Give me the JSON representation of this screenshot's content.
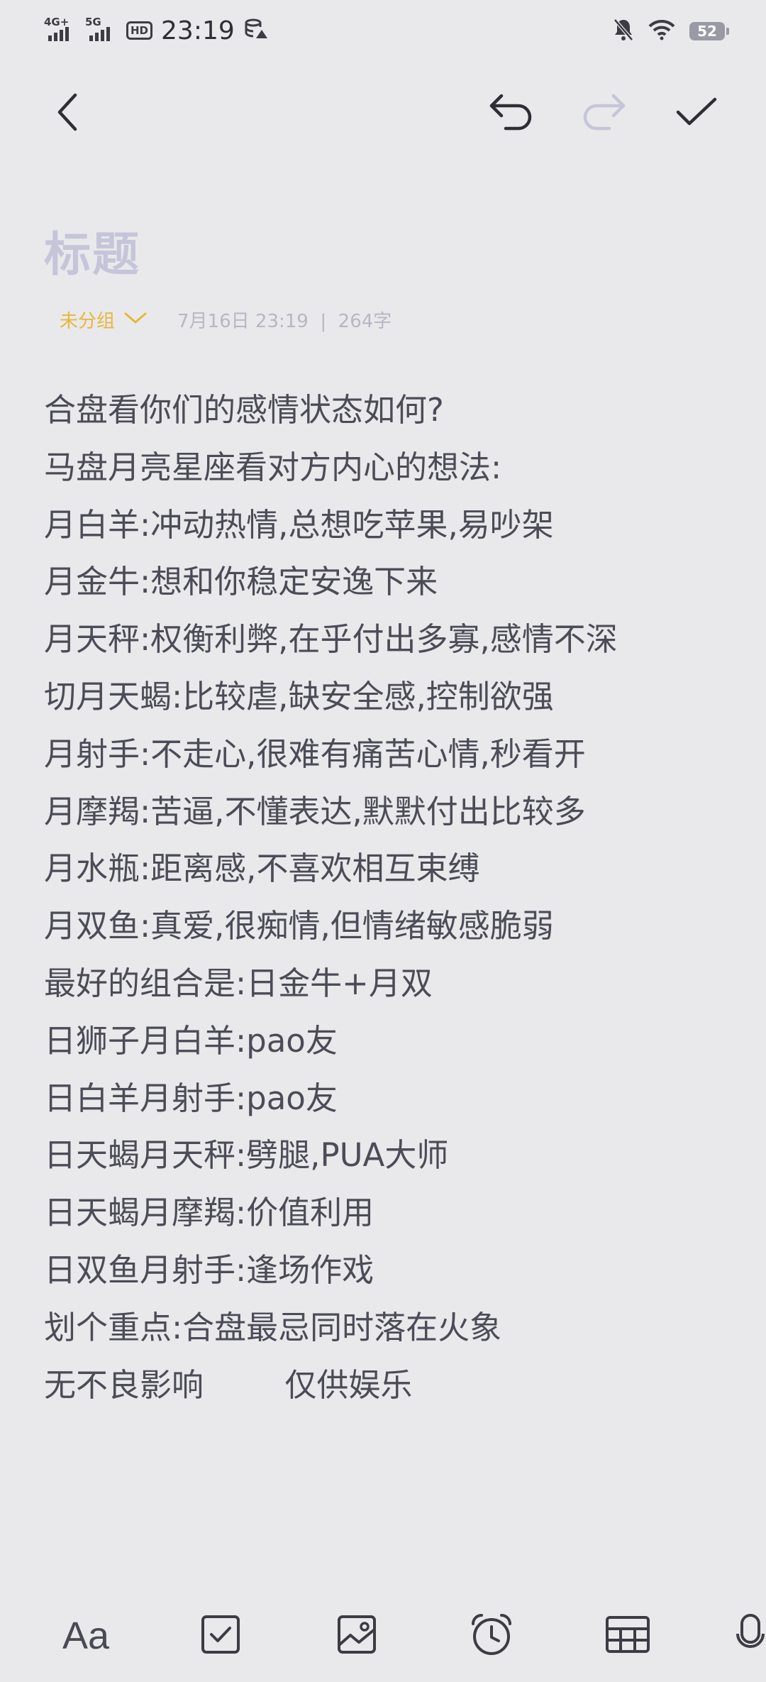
{
  "status_bar": {
    "network1": "4G+",
    "network2": "5G",
    "hd": "HD",
    "time": "23:19",
    "battery": "52"
  },
  "toolbar": {
    "back": "back-icon",
    "undo": "undo-icon",
    "redo": "redo-icon",
    "done": "check-icon"
  },
  "note": {
    "title_placeholder": "标题",
    "group": "未分组",
    "meta": "7月16日 23:19  |  264字",
    "lines": [
      "合盘看你们的感情状态如何?",
      "马盘月亮星座看对方内心的想法:",
      "月白羊:冲动热情,总想吃苹果,易吵架",
      "月金牛:想和你稳定安逸下来",
      "月天秤:权衡利弊,在乎付出多寡,感情不深",
      "切月天蝎:比较虐,缺安全感,控制欲强",
      "月射手:不走心,很难有痛苦心情,秒看开",
      "月摩羯:苦逼,不懂表达,默默付出比较多",
      "月水瓶:距离感,不喜欢相互束缚",
      "月双鱼:真爱,很痴情,但情绪敏感脆弱",
      "最好的组合是:日金牛+月双",
      "日狮子月白羊:pao友",
      "日白羊月射手:pao友",
      "日天蝎月天秤:劈腿,PUA大师",
      "日天蝎月摩羯:价值利用",
      "日双鱼月射手:逢场作戏",
      "划个重点:合盘最忌同时落在火象",
      "无不良影响        仅供娱乐"
    ]
  },
  "bottom_bar": {
    "text_format": "Aa",
    "checklist": "checkbox-icon",
    "image": "image-icon",
    "alarm": "alarm-icon",
    "table": "table-icon",
    "mic": "microphone-icon"
  }
}
